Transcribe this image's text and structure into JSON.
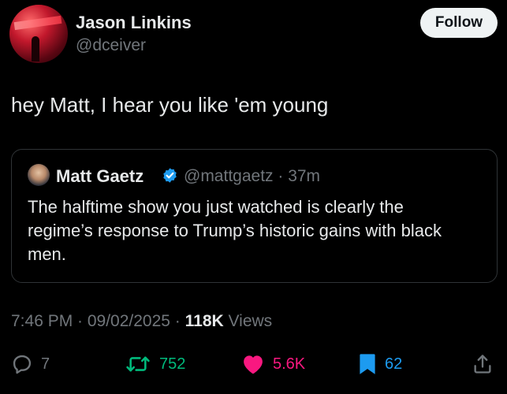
{
  "author": {
    "name": "Jason Linkins",
    "handle": "@dceiver",
    "follow_label": "Follow"
  },
  "tweet": {
    "text": "hey Matt, I hear you like 'em young"
  },
  "quoted": {
    "name": "Matt Gaetz",
    "handle_time": "@mattgaetz · 37m",
    "verified_icon": "verified-badge-icon",
    "text": "The halftime show you just watched is clearly the regime’s response to Trump’s historic gains with black men."
  },
  "meta": {
    "time_date": "7:46 PM · 09/02/2025 · ",
    "views_count": "118K",
    "views_label": " Views"
  },
  "actions": {
    "replies": "7",
    "reposts": "752",
    "likes": "5.6K",
    "bookmarks": "62"
  },
  "colors": {
    "background": "#000000",
    "text": "#e7e9ea",
    "muted": "#71767b",
    "repost_active": "#00ba7c",
    "like_active": "#f91880",
    "bookmark_active": "#1d9bf0",
    "verified": "#1d9bf0"
  }
}
